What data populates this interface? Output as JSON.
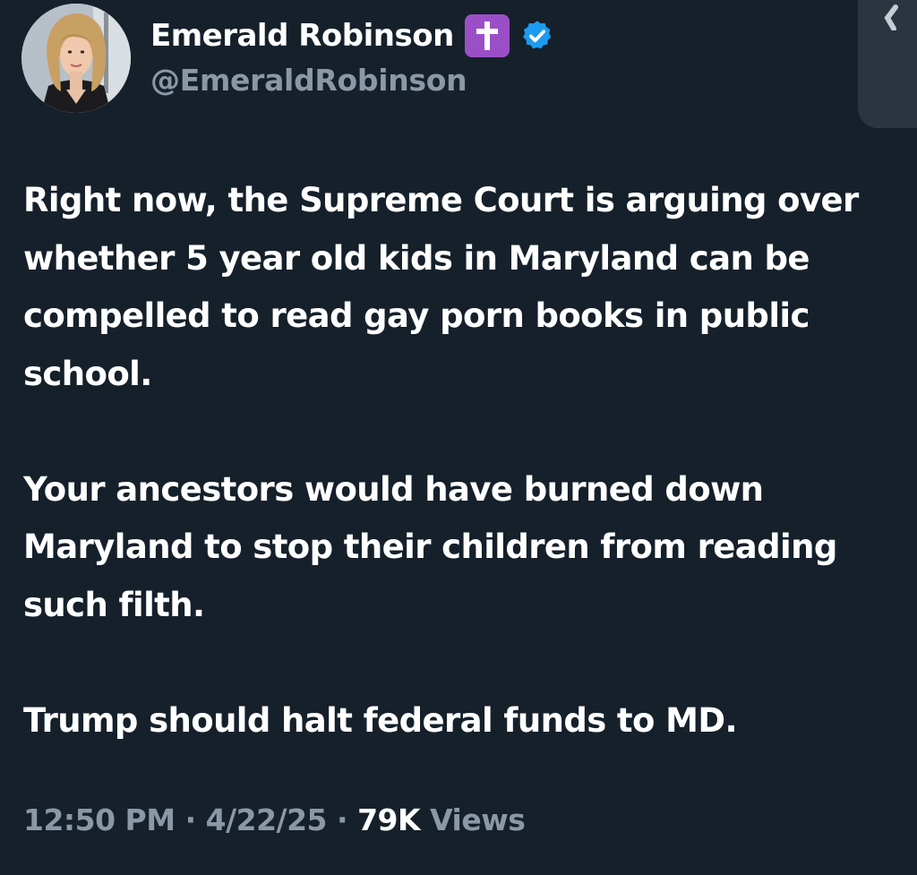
{
  "author": {
    "display_name": "Emerald Robinson",
    "handle": "@EmeraldRobinson",
    "name_emoji": "cross-emoji",
    "verified_badge_color": "#1d9bf0"
  },
  "tweet": {
    "paragraphs": [
      "Right now, the Supreme Court is arguing over whether 5 year old kids in Maryland can be compelled to read gay porn books in public school.",
      "Your ancestors would have burned down Maryland to stop their children from reading such filth.",
      "Trump should halt federal funds to MD."
    ]
  },
  "meta": {
    "time": "12:50 PM",
    "date": "4/22/25",
    "separator": "·",
    "views_count": "79K",
    "views_label": "Views"
  },
  "colors": {
    "background": "#15202b",
    "primary_text": "#ffffff",
    "secondary_text": "#8b98a5",
    "emoji_background": "#9b4fc7"
  }
}
